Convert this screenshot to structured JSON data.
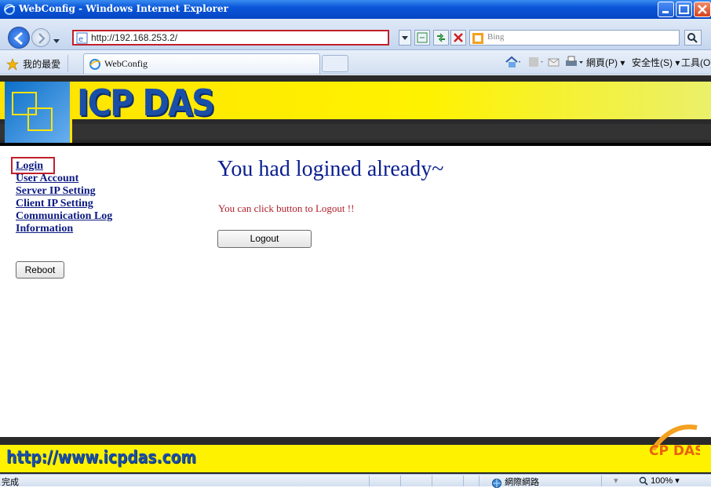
{
  "window": {
    "title": "WebConfig - Windows Internet Explorer"
  },
  "address": {
    "url": "http://192.168.253.2/"
  },
  "search": {
    "placeholder": "Bing"
  },
  "favorites": {
    "label": "我的最愛",
    "tab_label": "WebConfig"
  },
  "commandbar": {
    "page": "網頁(P)",
    "safety": "安全性(S)",
    "tools": "工具(O)"
  },
  "banner": {
    "logo_text": "ICP DAS"
  },
  "sidebar": {
    "items": [
      {
        "label": "Login"
      },
      {
        "label": "User Account"
      },
      {
        "label": "Server IP Setting"
      },
      {
        "label": "Client IP Setting"
      },
      {
        "label": "Communication Log"
      },
      {
        "label": "Information"
      }
    ],
    "reboot_label": "Reboot"
  },
  "main": {
    "headline": "You had logined already~",
    "message": "You can click button to Logout !!",
    "logout_label": "Logout"
  },
  "footer": {
    "url": "http://www.icpdas.com",
    "badge": "ICP DAS"
  },
  "status": {
    "left": "完成",
    "zone": "網際網路",
    "zoom": "100%"
  },
  "colors": {
    "accent_red": "#c0202a",
    "link_blue": "#0c1a82",
    "banner_yellow": "#fff200",
    "logo_blue": "#1a4fa8"
  }
}
